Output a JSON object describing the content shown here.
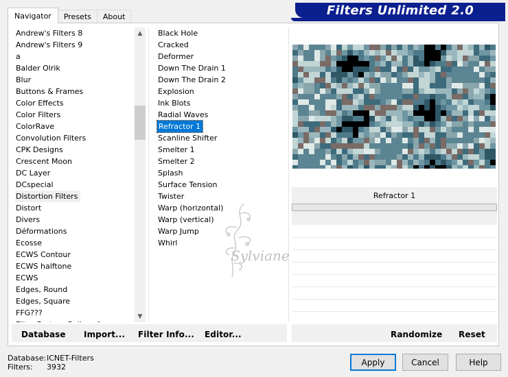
{
  "tabs": [
    {
      "label": "Navigator",
      "active": true
    },
    {
      "label": "Presets",
      "active": false
    },
    {
      "label": "About",
      "active": false
    }
  ],
  "banner": {
    "title": "Filters Unlimited 2.0"
  },
  "categories": {
    "items": [
      "Andrew's Filters 8",
      "Andrew's Filters 9",
      "a",
      "Balder Olrik",
      "Blur",
      "Buttons & Frames",
      "Color Effects",
      "Color Filters",
      "ColorRave",
      "Convolution Filters",
      "CPK Designs",
      "Crescent Moon",
      "DC Layer",
      "DCspecial",
      "Distortion Filters",
      "Distort",
      "Divers",
      "Déformations",
      "Ecosse",
      "ECWS Contour",
      "ECWS halftone",
      "ECWS",
      "Edges, Round",
      "Edges, Square",
      "FFG???",
      "Filter Factory Gallery A"
    ],
    "selected": "Distortion Filters",
    "scroll_up_icon": "scroll-up-arrow-icon",
    "scroll_down_icon": "scroll-down-arrow-icon"
  },
  "filters": {
    "items": [
      "Black Hole",
      "Cracked",
      "Deformer",
      "Down The Drain 1",
      "Down The Drain 2",
      "Explosion",
      "Ink Blots",
      "Radial Waves",
      "Refractor 1",
      "Scanline Shifter",
      "Smelter 1",
      "Smelter 2",
      "Splash",
      "Surface Tension",
      "Twister",
      "Warp (horizontal)",
      "Warp (vertical)",
      "Warp Jump",
      "Whirl"
    ],
    "selected": "Refractor 1"
  },
  "preview": {
    "filter_name": "Refractor 1",
    "palette": [
      "#2f5766",
      "#4e7a8a",
      "#6f97a3",
      "#9ab7bd",
      "#c2d6d6",
      "#7a6b66",
      "#3d6b7c",
      "#8aa6ad",
      "#dfe9e7",
      "#5c8593"
    ]
  },
  "buttons_left": {
    "database": "Database",
    "import": "Import...",
    "filter_info": "Filter Info...",
    "editor": "Editor..."
  },
  "buttons_right": {
    "randomize": "Randomize",
    "reset": "Reset"
  },
  "status": {
    "database_label": "Database:",
    "database_value": "ICNET-Filters",
    "filters_label": "Filters:",
    "filters_value": "3932"
  },
  "dialog_buttons": {
    "apply": "Apply",
    "cancel": "Cancel",
    "help": "Help"
  },
  "watermark": {
    "text": "Sylviane"
  }
}
